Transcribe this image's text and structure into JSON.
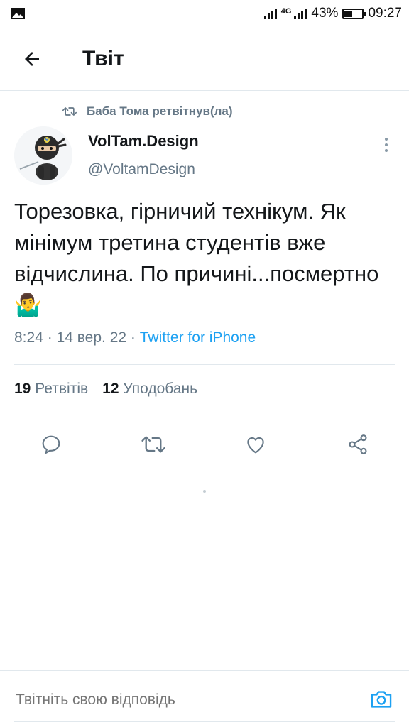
{
  "status_bar": {
    "network": "4G",
    "battery_percent": "43%",
    "time": "09:27",
    "icons": [
      "image-notification-icon",
      "signal-icon",
      "signal-icon",
      "battery-icon"
    ]
  },
  "header": {
    "title": "Твіт",
    "back_icon": "arrow-left-icon"
  },
  "tweet": {
    "retweeted_by": "Баба Тома ретвітнув(ла)",
    "author_name": "VolTam.Design",
    "author_handle": "@VoltamDesign",
    "text": "Торезовка, гірничий технікум. Як мінімум третина студентів вже відчислина. По причині...посмертно 🤷‍♂️",
    "time": "8:24",
    "date": "14 вер. 22",
    "separator": "·",
    "source": "Twitter for iPhone",
    "retweets_count": "19",
    "retweets_label": "Ретвітів",
    "likes_count": "12",
    "likes_label": "Уподобань"
  },
  "actions": [
    "reply-icon",
    "retweet-icon",
    "like-icon",
    "share-icon"
  ],
  "reply": {
    "placeholder": "Твітніть свою відповідь",
    "camera_icon": "camera-icon"
  },
  "colors": {
    "accent": "#1da1f2",
    "secondary_text": "#657786",
    "divider": "#e1e8ed"
  }
}
